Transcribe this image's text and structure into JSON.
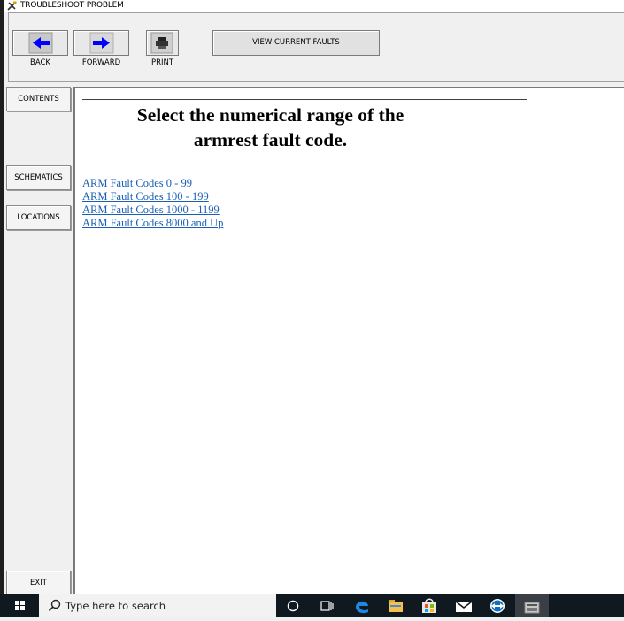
{
  "window": {
    "title": "TROUBLESHOOT PROBLEM"
  },
  "toolbar": {
    "back_label": "BACK",
    "forward_label": "FORWARD",
    "print_label": "PRINT",
    "view_faults_label": "VIEW CURRENT FAULTS"
  },
  "sidebar": {
    "contents_label": "CONTENTS",
    "schematics_label": "SCHEMATICS",
    "locations_label": "LOCATIONS",
    "exit_label": "EXIT"
  },
  "content": {
    "heading_line1": "Select the numerical range of the",
    "heading_line2": "armrest fault code.",
    "links": [
      "ARM Fault Codes 0 - 99",
      "ARM Fault Codes 100 - 199",
      "ARM Fault Codes 1000 - 1199",
      "ARM Fault Codes 8000 and Up"
    ]
  },
  "taskbar": {
    "search_placeholder": "Type here to search",
    "icons": [
      "cortana-icon",
      "task-view-icon",
      "edge-icon",
      "file-explorer-icon",
      "store-icon",
      "mail-icon",
      "teamviewer-icon",
      "app-icon"
    ]
  },
  "colors": {
    "link": "#1a5fb4",
    "arrow": "#0000ff",
    "taskbar": "#101820"
  }
}
